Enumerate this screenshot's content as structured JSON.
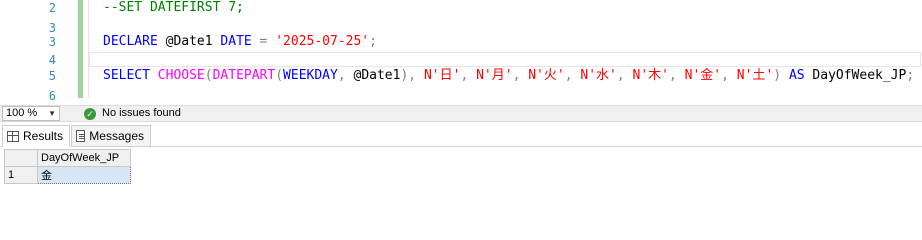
{
  "editor": {
    "lines": [
      {
        "num": "2",
        "tokens": [
          {
            "t": "--SET DATEFIRST 7;",
            "c": "cm"
          }
        ]
      },
      {
        "num": "3",
        "tokens": []
      },
      {
        "num": "3",
        "tokens": [
          {
            "t": "DECLARE",
            "c": "kw"
          },
          {
            "t": " @Date1 ",
            "c": "id"
          },
          {
            "t": "DATE",
            "c": "kw"
          },
          {
            "t": " = ",
            "c": "op"
          },
          {
            "t": "'2025-07-25'",
            "c": "str"
          },
          {
            "t": ";",
            "c": "op"
          }
        ]
      },
      {
        "num": "4",
        "tokens": []
      },
      {
        "num": "5",
        "tokens": [
          {
            "t": "SELECT",
            "c": "kw"
          },
          {
            "t": " ",
            "c": "id"
          },
          {
            "t": "CHOOSE",
            "c": "fn"
          },
          {
            "t": "(",
            "c": "op"
          },
          {
            "t": "DATEPART",
            "c": "fn"
          },
          {
            "t": "(",
            "c": "op"
          },
          {
            "t": "WEEKDAY",
            "c": "kw"
          },
          {
            "t": ", ",
            "c": "op"
          },
          {
            "t": "@Date1",
            "c": "id"
          },
          {
            "t": "), ",
            "c": "op"
          },
          {
            "t": "N'日'",
            "c": "str"
          },
          {
            "t": ", ",
            "c": "op"
          },
          {
            "t": "N'月'",
            "c": "str"
          },
          {
            "t": ", ",
            "c": "op"
          },
          {
            "t": "N'火'",
            "c": "str"
          },
          {
            "t": ", ",
            "c": "op"
          },
          {
            "t": "N'水'",
            "c": "str"
          },
          {
            "t": ", ",
            "c": "op"
          },
          {
            "t": "N'木'",
            "c": "str"
          },
          {
            "t": ", ",
            "c": "op"
          },
          {
            "t": "N'金'",
            "c": "str"
          },
          {
            "t": ", ",
            "c": "op"
          },
          {
            "t": "N'土'",
            "c": "str"
          },
          {
            "t": ") ",
            "c": "op"
          },
          {
            "t": "AS",
            "c": "kw"
          },
          {
            "t": " DayOfWeek_JP",
            "c": "id"
          },
          {
            "t": ";",
            "c": "op"
          }
        ]
      },
      {
        "num": "6",
        "tokens": []
      }
    ]
  },
  "statusbar": {
    "zoom": "100 %",
    "issues": "No issues found"
  },
  "tabs": {
    "results": "Results",
    "messages": "Messages"
  },
  "grid": {
    "columns": [
      "DayOfWeek_JP"
    ],
    "rows": [
      {
        "row_num": "1",
        "values": [
          "金"
        ]
      }
    ]
  },
  "colors": {
    "keyword": "#0000ff",
    "function": "#ff00ff",
    "string": "#ff0000",
    "comment": "#008000",
    "line_number": "#2b91af",
    "change_bar": "#9fd39f"
  },
  "icons": {
    "issues": "check-circle-icon",
    "results_tab": "grid-icon",
    "messages_tab": "message-icon",
    "zoom_dropdown": "chevron-down-icon"
  }
}
